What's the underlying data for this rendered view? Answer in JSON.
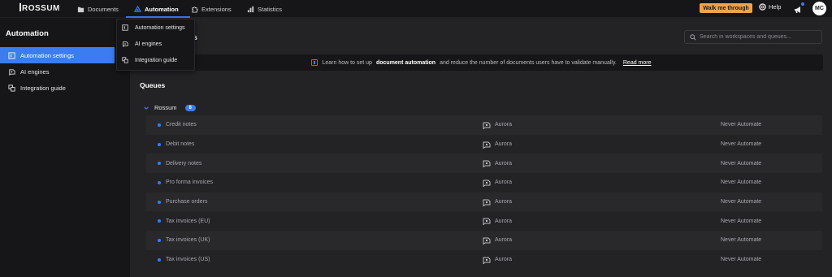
{
  "brand": {
    "name": "ROSSUM",
    "accent": "#3b7cf0"
  },
  "nav": {
    "documents": "Documents",
    "automation": "Automation",
    "extensions": "Extensions",
    "statistics": "Statistics"
  },
  "topbar": {
    "walk_me_through": "Walk me through",
    "help": "Help",
    "avatar_initials": "MC"
  },
  "sidebar": {
    "title": "Automation",
    "items": [
      {
        "label": "Automation settings",
        "icon": "automation-settings-icon"
      },
      {
        "label": "AI engines",
        "icon": "ai-engines-icon"
      },
      {
        "label": "Integration guide",
        "icon": "integration-guide-icon"
      }
    ]
  },
  "dropdown": {
    "items": [
      {
        "label": "Automation settings"
      },
      {
        "label": "AI engines"
      },
      {
        "label": "Integration guide"
      }
    ]
  },
  "main": {
    "title_visible": "ngs",
    "search_placeholder": "Search in workspaces and queues...",
    "banner": {
      "prefix": "Learn how to set up",
      "strong": "document automation",
      "suffix": "and reduce the number of documents users have to validate manually.",
      "link": "Read more"
    },
    "section_title": "Queues",
    "workspace": {
      "name": "Rossum",
      "count": "8"
    },
    "queues": [
      {
        "name": "Credit notes",
        "engine": "Aurora",
        "mode": "Never Automate"
      },
      {
        "name": "Debit notes",
        "engine": "Aurora",
        "mode": "Never Automate"
      },
      {
        "name": "Delivery notes",
        "engine": "Aurora",
        "mode": "Never Automate"
      },
      {
        "name": "Pro forma invoices",
        "engine": "Aurora",
        "mode": "Never Automate"
      },
      {
        "name": "Purchase orders",
        "engine": "Aurora",
        "mode": "Never Automate"
      },
      {
        "name": "Tax invoices (EU)",
        "engine": "Aurora",
        "mode": "Never Automate"
      },
      {
        "name": "Tax invoices (UK)",
        "engine": "Aurora",
        "mode": "Never Automate"
      },
      {
        "name": "Tax invoices (US)",
        "engine": "Aurora",
        "mode": "Never Automate"
      }
    ]
  }
}
